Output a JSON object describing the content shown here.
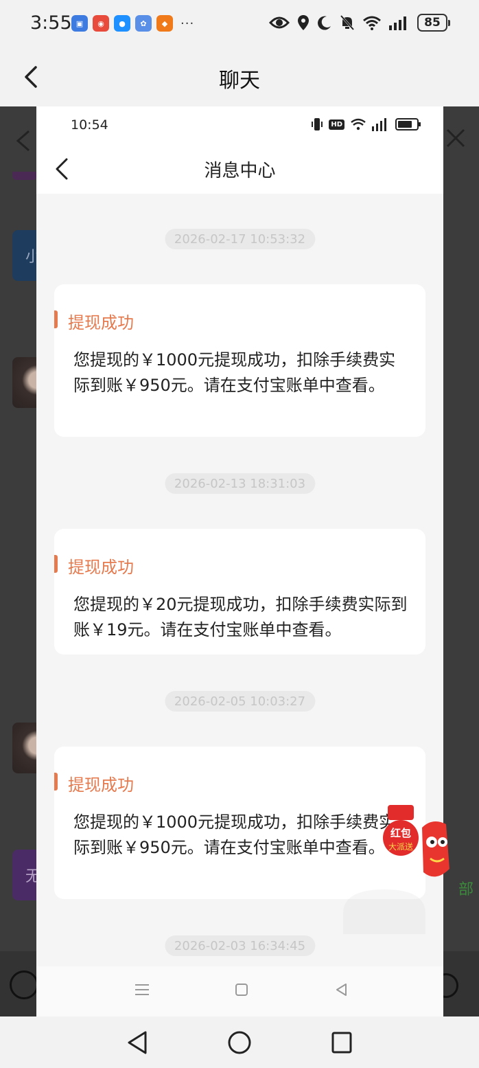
{
  "status_bar": {
    "time": "3:55",
    "battery": "85",
    "app_icons": [
      {
        "name": "app-icon-1",
        "color": "#3d7be0"
      },
      {
        "name": "app-icon-2",
        "color": "#e84b3c"
      },
      {
        "name": "app-icon-3",
        "color": "#1e90ff"
      },
      {
        "name": "app-icon-4",
        "color": "#5a8fe8"
      },
      {
        "name": "app-icon-5",
        "color": "#f07a1a"
      }
    ],
    "more": "···"
  },
  "outer_header": {
    "title": "聊天"
  },
  "background": {
    "avatar_blue_text": "小",
    "avatar_purple_text": "无",
    "green_text": "部"
  },
  "inner": {
    "status_time": "10:54",
    "hd_badge": "HD",
    "title": "消息中心",
    "messages": [
      {
        "timestamp": "2026-02-17 10:53:32",
        "title": "提现成功",
        "body": "您提现的￥1000元提现成功，扣除手续费实际到账￥950元。请在支付宝账单中查看。"
      },
      {
        "timestamp": "2026-02-13 18:31:03",
        "title": "提现成功",
        "body": "您提现的￥20元提现成功，扣除手续费实际到账￥19元。请在支付宝账单中查看。"
      },
      {
        "timestamp": "2026-02-05 10:03:27",
        "title": "提现成功",
        "body": "您提现的￥1000元提现成功，扣除手续费实际到账￥950元。请在支付宝账单中查看。"
      },
      {
        "timestamp": "2026-02-03 16:34:45"
      }
    ]
  },
  "red_packet": {
    "label1": "红包",
    "label2": "大派送"
  },
  "colors": {
    "accent": "#e57a4f",
    "dim_overlay": "#3c3c3c"
  }
}
